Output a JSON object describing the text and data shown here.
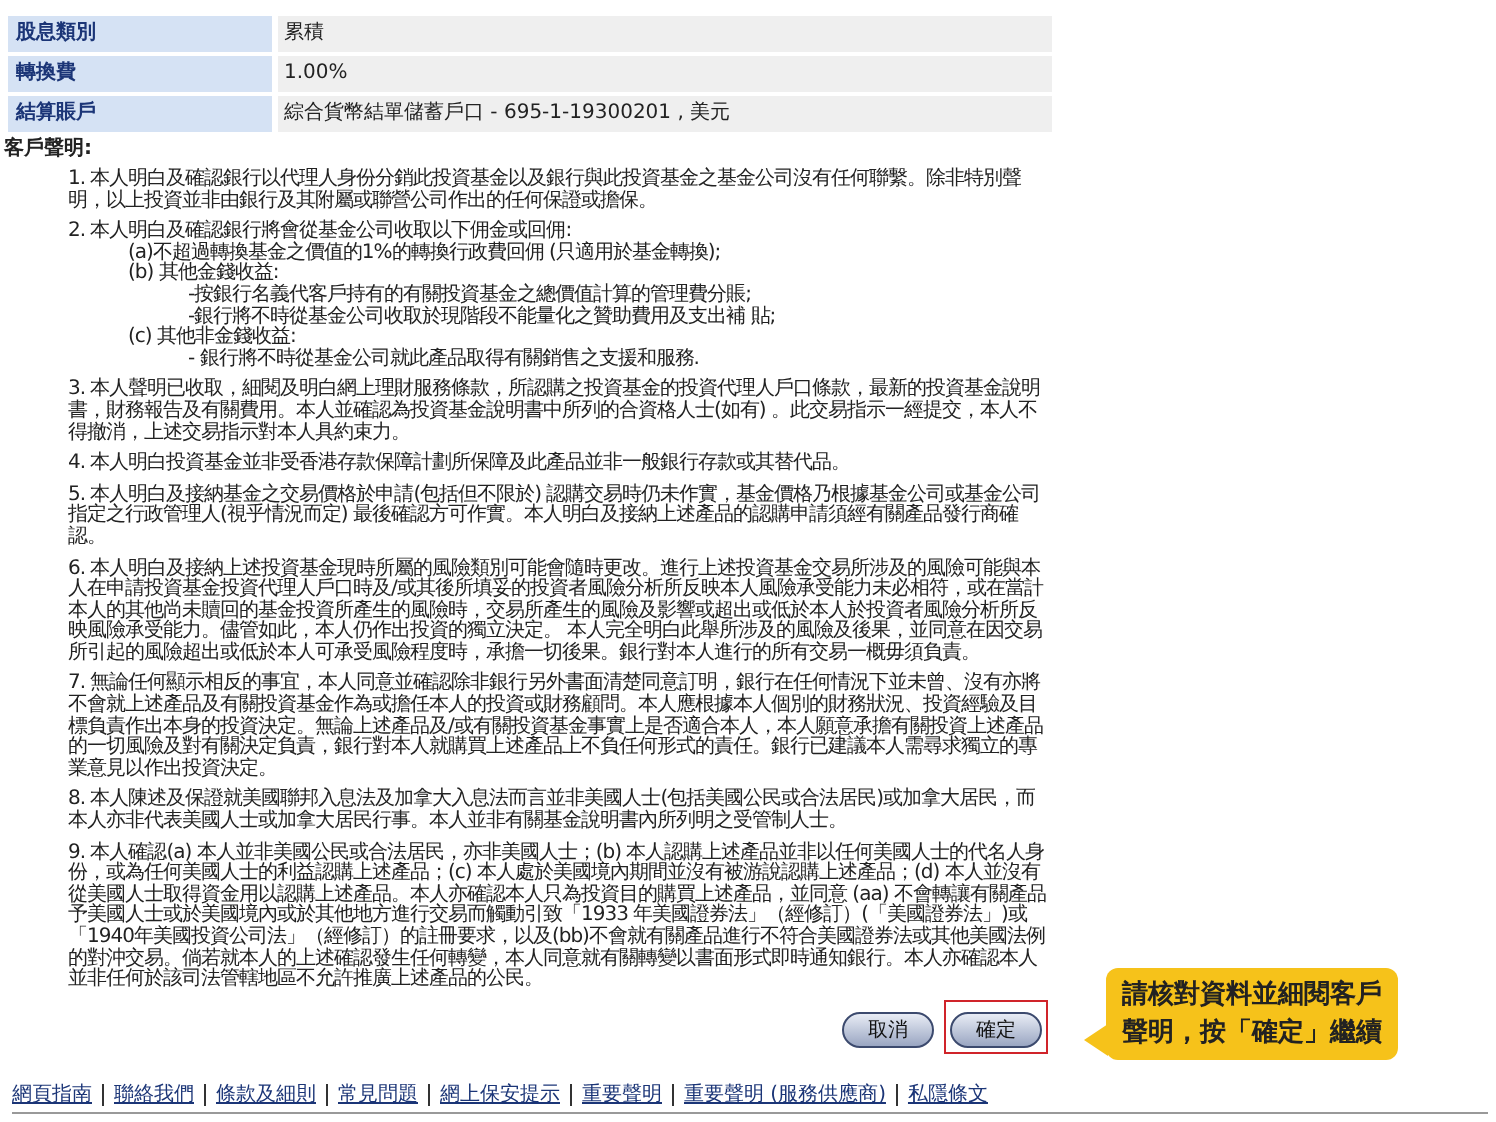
{
  "details": [
    {
      "label": "股息類別",
      "value": "累積"
    },
    {
      "label": "轉換費",
      "value": "1.00%"
    },
    {
      "label": "結算賬戶",
      "value": "綜合貨幣結單儲蓄戶口 - 695-1-19300201 , 美元"
    }
  ],
  "declaration_title": "客戶聲明:",
  "declarations": [
    {
      "text": "1. 本人明白及確認銀行以代理人身份分銷此投資基金以及銀行與此投資基金之基金公司沒有任何聯繫。除非特別聲明，以上投資並非由銀行及其附屬或聯營公司作出的任何保證或擔保。"
    },
    {
      "text": "2. 本人明白及確認銀行將會從基金公司收取以下佣金或回佣:",
      "children": [
        {
          "text": "(a)不超過轉換基金之價值的1%的轉換行政費回佣 (只適用於基金轉換);"
        },
        {
          "text": "(b) 其他金錢收益:",
          "children": [
            {
              "text": "-按銀行名義代客戶持有的有關投資基金之總價值計算的管理費分賬;"
            },
            {
              "text": "-銀行將不時從基金公司收取於現階段不能量化之贊助費用及支出補 貼;"
            }
          ]
        },
        {
          "text": "(c) 其他非金錢收益:",
          "children": [
            {
              "text": "- 銀行將不時從基金公司就此產品取得有關銷售之支援和服務."
            }
          ]
        }
      ]
    },
    {
      "text": "3. 本人聲明已收取，細閱及明白網上理財服務條款，所認購之投資基金的投資代理人戶口條款，最新的投資基金說明書，財務報告及有關費用。本人並確認為投資基金說明書中所列的合資格人士(如有) 。此交易指示一經提交，本人不得撤消，上述交易指示對本人具約束力。"
    },
    {
      "text": "4. 本人明白投資基金並非受香港存款保障計劃所保障及此產品並非一般銀行存款或其替代品。"
    },
    {
      "text": "5. 本人明白及接納基金之交易價格於申請(包括但不限於) 認購交易時仍未作實，基金價格乃根據基金公司或基金公司指定之行政管理人(視乎情況而定) 最後確認方可作實。本人明白及接納上述產品的認購申請須經有關產品發行商確認。"
    },
    {
      "text": "6. 本人明白及接納上述投資基金現時所屬的風險類別可能會隨時更改。進行上述投資基金交易所涉及的風險可能與本人在申請投資基金投資代理人戶口時及/或其後所填妥的投資者風險分析所反映本人風險承受能力未必相符，或在當計本人的其他尚未贖回的基金投資所產生的風險時，交易所產生的風險及影響或超出或低於本人於投資者風險分析所反映風險承受能力。儘管如此，本人仍作出投資的獨立決定。 本人完全明白此舉所涉及的風險及後果，並同意在因交易所引起的風險超出或低於本人可承受風險程度時，承擔一切後果。銀行對本人進行的所有交易一概毋須負責。"
    },
    {
      "text": "7. 無論任何顯示相反的事宜，本人同意並確認除非銀行另外書面清楚同意訂明，銀行在任何情況下並未曾、沒有亦將不會就上述產品及有關投資基金作為或擔任本人的投資或財務顧問。本人應根據本人個別的財務狀況、投資經驗及目標負責作出本身的投資決定。無論上述產品及/或有關投資基金事實上是否適合本人，本人願意承擔有關投資上述產品的一切風險及對有關決定負責，銀行對本人就購買上述產品上不負任何形式的責任。銀行已建議本人需尋求獨立的專業意見以作出投資決定。"
    },
    {
      "text": "8. 本人陳述及保證就美國聯邦入息法及加拿大入息法而言並非美國人士(包括美國公民或合法居民)或加拿大居民，而本人亦非代表美國人士或加拿大居民行事。本人並非有關基金說明書內所列明之受管制人士。"
    },
    {
      "text": "9. 本人確認(a) 本人並非美國公民或合法居民，亦非美國人士；(b) 本人認購上述產品並非以任何美國人士的代名人身份，或為任何美國人士的利益認購上述產品；(c) 本人處於美國境內期間並沒有被游說認購上述產品；(d) 本人並沒有從美國人士取得資金用以認購上述產品。本人亦確認本人只為投資目的購買上述產品，並同意 (aa) 不會轉讓有關產品予美國人士或於美國境內或於其他地方進行交易而觸動引致「1933 年美國證券法」（經修訂）(「美國證券法」)或「1940年美國投資公司法」（經修訂）的註冊要求，以及(bb)不會就有關產品進行不符合美國證券法或其他美國法例的對沖交易。倘若就本人的上述確認發生任何轉變，本人同意就有關轉變以書面形式即時通知銀行。本人亦確認本人並非任何於該司法管轄地區不允許推廣上述產品的公民。"
    }
  ],
  "buttons": [
    {
      "label": "取消",
      "highlighted": false
    },
    {
      "label": "確定",
      "highlighted": true
    }
  ],
  "callout": {
    "lines": [
      "請核對資料並細閱客戶",
      "聲明，按「確定」繼續"
    ]
  },
  "footer_links": [
    "網頁指南",
    "聯絡我們",
    "條款及細則",
    "常見問題",
    "網上保安提示",
    "重要聲明",
    "重要聲明 (服務供應商)",
    "私隱條文"
  ]
}
